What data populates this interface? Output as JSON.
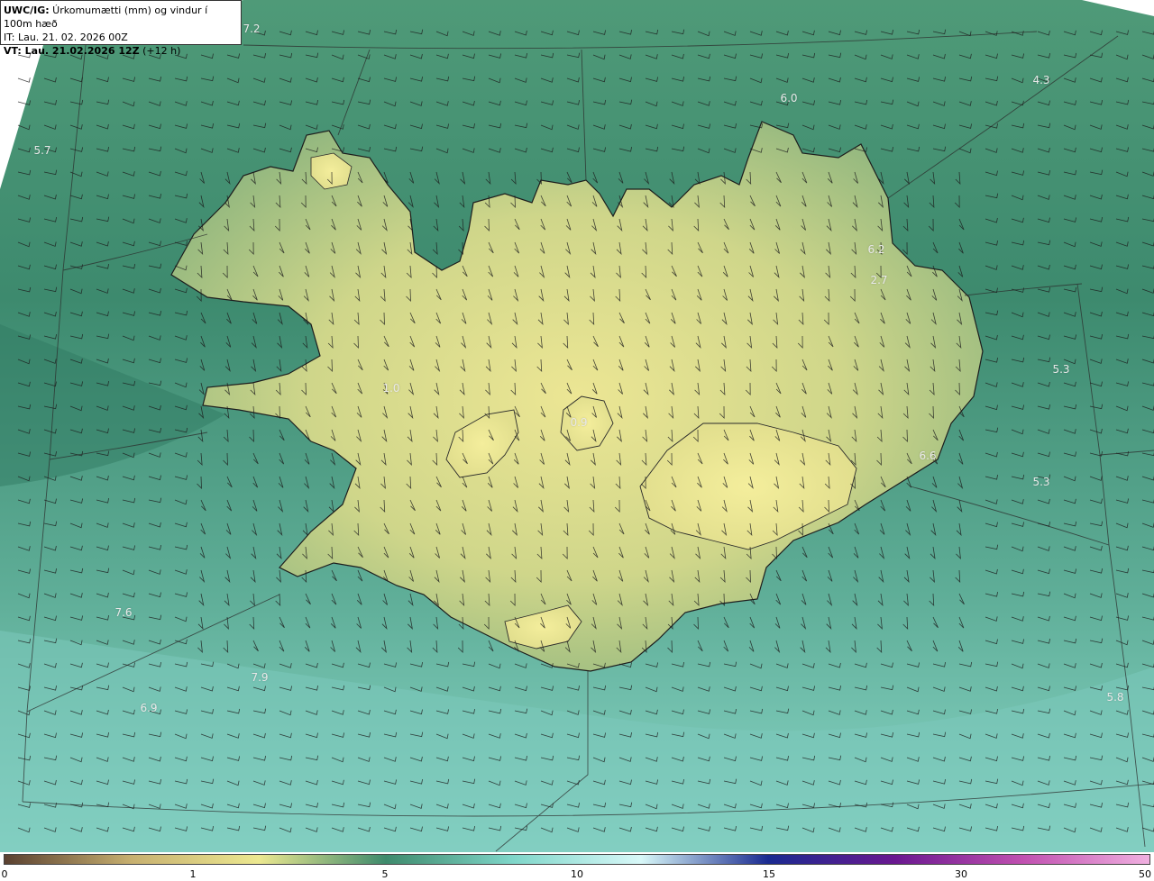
{
  "header": {
    "title_bold": "UWC/IG:",
    "title_rest": " Úrkomumætti (mm) og vindur í 100m hæð",
    "it_prefix": "IT:",
    "it_text": " Lau. 21. 02. 2026 00Z",
    "vt_bold": "VT: Lau. 21.02.2026 12Z",
    "vt_rest": " (+12 h)"
  },
  "map_labels": [
    {
      "text": "7.2"
    },
    {
      "text": "4.3"
    },
    {
      "text": "6.0"
    },
    {
      "text": "5.7"
    },
    {
      "text": "6.2"
    },
    {
      "text": "2.7"
    },
    {
      "text": "5.3"
    },
    {
      "text": "1.0"
    },
    {
      "text": "0.9"
    },
    {
      "text": "6.6"
    },
    {
      "text": "5.3"
    },
    {
      "text": "7.6"
    },
    {
      "text": "7.9"
    },
    {
      "text": "6.9"
    },
    {
      "text": "5.8"
    }
  ],
  "colorbar": {
    "ticks": [
      "0",
      "1",
      "5",
      "10",
      "15",
      "30",
      "50"
    ],
    "colors": [
      "#5a4030",
      "#c7b070",
      "#ece890",
      "#3e8a6c",
      "#7fd6c9",
      "#d8f8f8",
      "#1a2a90",
      "#6a1890",
      "#c050b0",
      "#f0b0e0"
    ]
  },
  "colors": {
    "land_high": "#e6e290",
    "land_mid": "#b8c986",
    "sea_dark": "#3f8a70",
    "sea_light": "#7fcfc2"
  }
}
